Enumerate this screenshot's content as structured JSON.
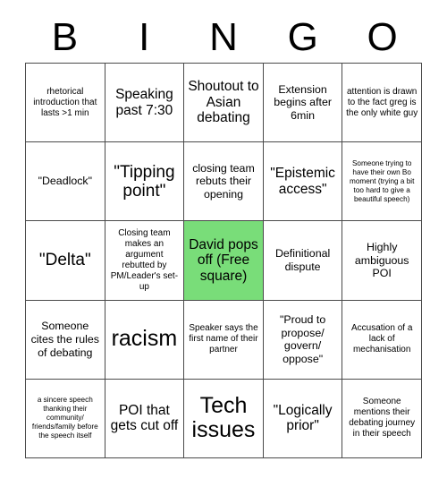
{
  "header": {
    "letters": [
      "B",
      "I",
      "N",
      "G",
      "O"
    ]
  },
  "colors": {
    "free_square_fill": "#79dd79",
    "grid_line": "#4a4a4a",
    "cell_fill": "#ffffff",
    "text": "#000000"
  },
  "grid": {
    "columns": 5,
    "rows": 5,
    "cells": [
      {
        "row": 1,
        "col": 1,
        "text": "rhetorical introduction that lasts >1 min",
        "size": "s",
        "free": false
      },
      {
        "row": 1,
        "col": 2,
        "text": "Speaking past 7:30",
        "size": "l",
        "free": false
      },
      {
        "row": 1,
        "col": 3,
        "text": "Shoutout to Asian debating",
        "size": "l",
        "free": false
      },
      {
        "row": 1,
        "col": 4,
        "text": "Extension begins after 6min",
        "size": "m",
        "free": false
      },
      {
        "row": 1,
        "col": 5,
        "text": "attention is drawn to the fact greg is the only white guy",
        "size": "s",
        "free": false
      },
      {
        "row": 2,
        "col": 1,
        "text": "\"Deadlock\"",
        "size": "m",
        "free": false
      },
      {
        "row": 2,
        "col": 2,
        "text": "\"Tipping point\"",
        "size": "xl",
        "free": false
      },
      {
        "row": 2,
        "col": 3,
        "text": "closing team rebuts their opening",
        "size": "m",
        "free": false
      },
      {
        "row": 2,
        "col": 4,
        "text": "\"Epistemic access\"",
        "size": "l",
        "free": false
      },
      {
        "row": 2,
        "col": 5,
        "text": "Someone trying to have their own Bo moment (trying a bit too hard to give a beautiful speech)",
        "size": "xs",
        "free": false
      },
      {
        "row": 3,
        "col": 1,
        "text": "\"Delta\"",
        "size": "xl",
        "free": false
      },
      {
        "row": 3,
        "col": 2,
        "text": "Closing team makes an argument rebutted by PM/Leader's set-up",
        "size": "s",
        "free": false
      },
      {
        "row": 3,
        "col": 3,
        "text": "David pops off (Free square)",
        "size": "l",
        "free": true
      },
      {
        "row": 3,
        "col": 4,
        "text": "Definitional dispute",
        "size": "m",
        "free": false
      },
      {
        "row": 3,
        "col": 5,
        "text": "Highly ambiguous POI",
        "size": "m",
        "free": false
      },
      {
        "row": 4,
        "col": 1,
        "text": "Someone cites the rules of debating",
        "size": "m",
        "free": false
      },
      {
        "row": 4,
        "col": 2,
        "text": "racism",
        "size": "xxl",
        "free": false
      },
      {
        "row": 4,
        "col": 3,
        "text": "Speaker says the first name of their partner",
        "size": "s",
        "free": false
      },
      {
        "row": 4,
        "col": 4,
        "text": "\"Proud to propose/ govern/ oppose\"",
        "size": "m",
        "free": false
      },
      {
        "row": 4,
        "col": 5,
        "text": "Accusation of a lack of mechanisation",
        "size": "s",
        "free": false
      },
      {
        "row": 5,
        "col": 1,
        "text": "a sincere speech thanking their community/ friends/family before the speech itself",
        "size": "xs",
        "free": false
      },
      {
        "row": 5,
        "col": 2,
        "text": "POI that gets cut off",
        "size": "l",
        "free": false
      },
      {
        "row": 5,
        "col": 3,
        "text": "Tech issues",
        "size": "xxl",
        "free": false
      },
      {
        "row": 5,
        "col": 4,
        "text": "\"Logically prior\"",
        "size": "l",
        "free": false
      },
      {
        "row": 5,
        "col": 5,
        "text": "Someone mentions their debating journey in their speech",
        "size": "s",
        "free": false
      }
    ]
  }
}
